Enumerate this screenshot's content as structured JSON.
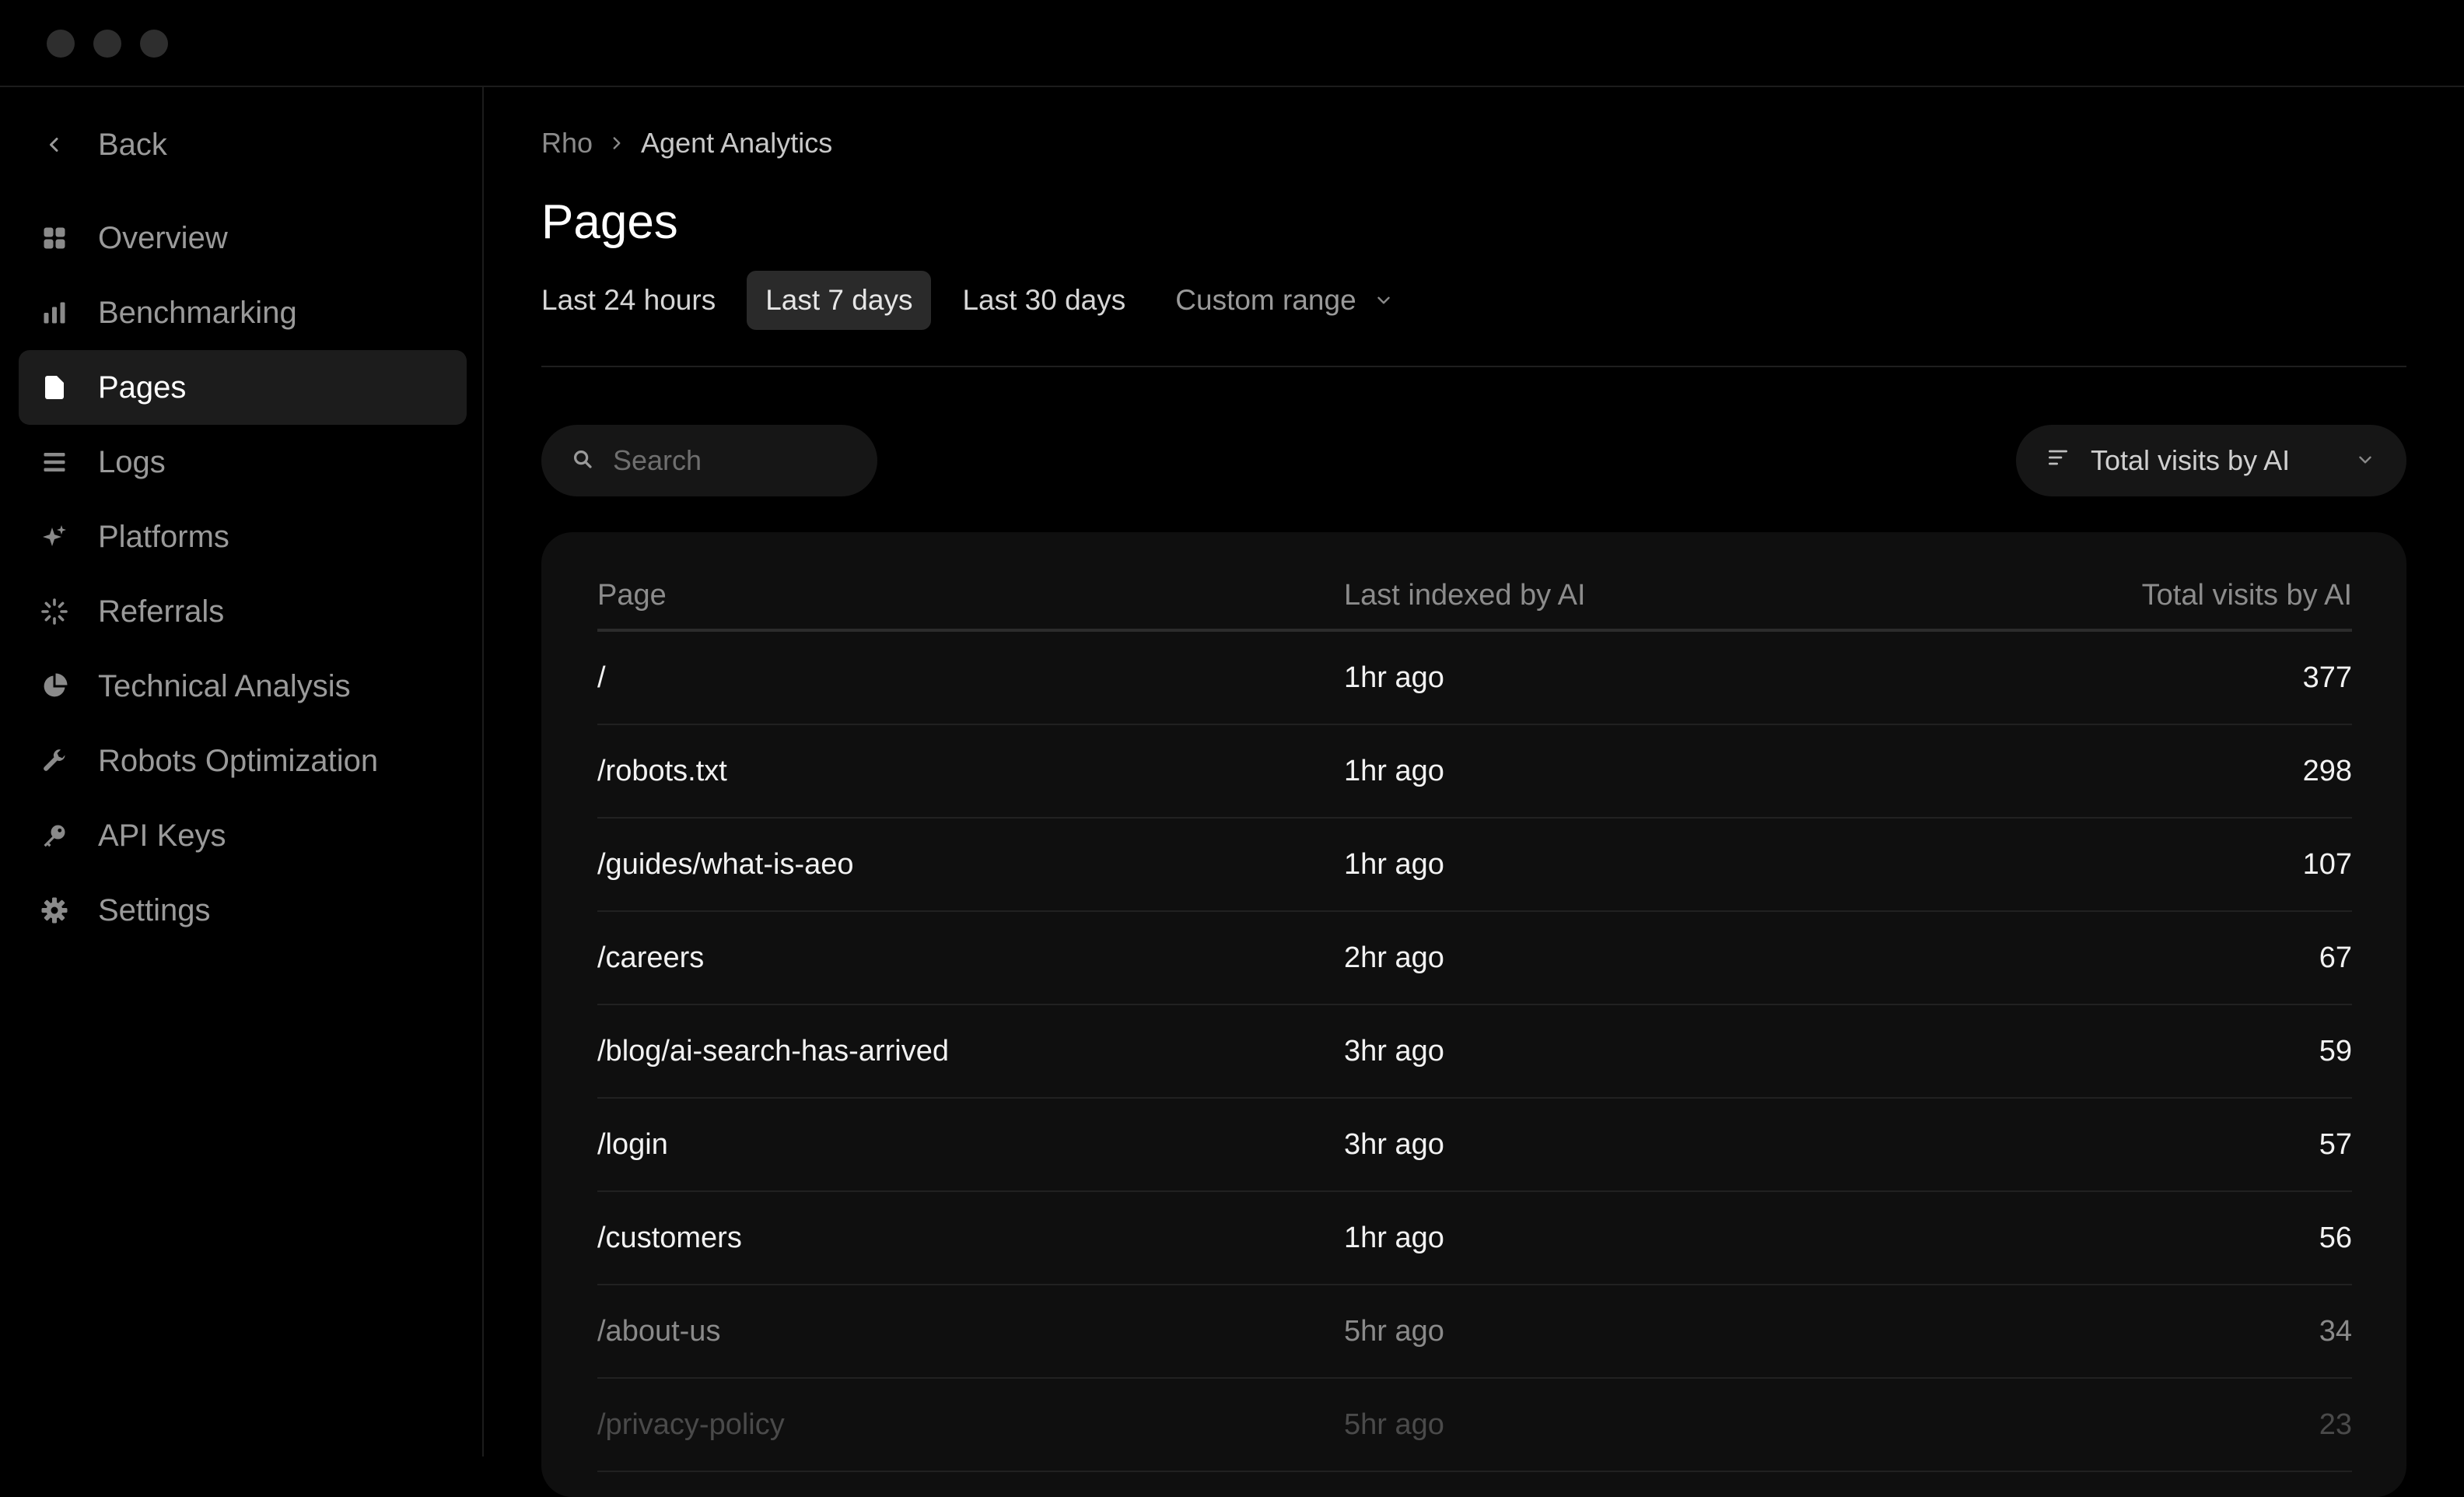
{
  "sidebar": {
    "back_label": "Back",
    "items": [
      {
        "label": "Overview",
        "icon": "grid-icon"
      },
      {
        "label": "Benchmarking",
        "icon": "bar-chart-icon"
      },
      {
        "label": "Pages",
        "icon": "document-icon",
        "active": true
      },
      {
        "label": "Logs",
        "icon": "list-icon"
      },
      {
        "label": "Platforms",
        "icon": "sparkles-icon"
      },
      {
        "label": "Referrals",
        "icon": "loader-icon"
      },
      {
        "label": "Technical Analysis",
        "icon": "pie-chart-icon"
      },
      {
        "label": "Robots Optimization",
        "icon": "wrench-icon"
      },
      {
        "label": "API Keys",
        "icon": "key-icon"
      },
      {
        "label": "Settings",
        "icon": "gear-icon"
      }
    ]
  },
  "breadcrumb": {
    "root": "Rho",
    "current": "Agent Analytics"
  },
  "page_title": "Pages",
  "range_tabs": [
    {
      "label": "Last 24 hours"
    },
    {
      "label": "Last 7 days",
      "active": true
    },
    {
      "label": "Last 30 days"
    },
    {
      "label": "Custom range"
    }
  ],
  "search": {
    "placeholder": "Search",
    "value": ""
  },
  "sort": {
    "label": "Total visits by AI"
  },
  "table": {
    "columns": [
      "Page",
      "Last indexed by AI",
      "Total visits by AI"
    ],
    "rows": [
      {
        "page": "/",
        "last_indexed": "1hr ago",
        "visits": "377"
      },
      {
        "page": "/robots.txt",
        "last_indexed": "1hr ago",
        "visits": "298"
      },
      {
        "page": "/guides/what-is-aeo",
        "last_indexed": "1hr ago",
        "visits": "107"
      },
      {
        "page": "/careers",
        "last_indexed": "2hr ago",
        "visits": "67"
      },
      {
        "page": "/blog/ai-search-has-arrived",
        "last_indexed": "3hr ago",
        "visits": "59"
      },
      {
        "page": "/login",
        "last_indexed": "3hr ago",
        "visits": "57"
      },
      {
        "page": "/customers",
        "last_indexed": "1hr ago",
        "visits": "56"
      },
      {
        "page": "/about-us",
        "last_indexed": "5hr ago",
        "visits": "34"
      },
      {
        "page": "/privacy-policy",
        "last_indexed": "5hr ago",
        "visits": "23"
      }
    ]
  }
}
